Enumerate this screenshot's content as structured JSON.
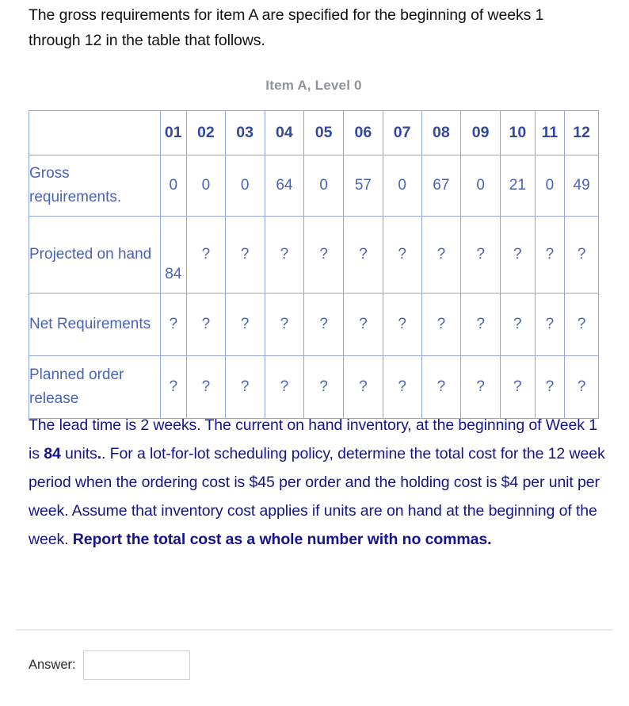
{
  "intro": {
    "text": "The gross requirements for item A are specified for the beginning of weeks 1 through 12 in the table that follows."
  },
  "table": {
    "caption": "Item A, Level 0",
    "corner_header": "",
    "column_headers": [
      "01",
      "02",
      "03",
      "04",
      "05",
      "06",
      "07",
      "08",
      "09",
      "10",
      "11",
      "12"
    ],
    "rows": [
      {
        "label": "Gross requirements.",
        "values": [
          "0",
          "0",
          "0",
          "64",
          "0",
          "57",
          "0",
          "67",
          "0",
          "21",
          "0",
          "49"
        ]
      },
      {
        "label": "Projected on hand",
        "values": [
          "84",
          "?",
          "?",
          "?",
          "?",
          "?",
          "?",
          "?",
          "?",
          "?",
          "?",
          "?"
        ]
      },
      {
        "label": "Net Requirements",
        "values": [
          "?",
          "?",
          "?",
          "?",
          "?",
          "?",
          "?",
          "?",
          "?",
          "?",
          "?",
          "?"
        ]
      },
      {
        "label": "Planned order release",
        "values": [
          "?",
          "?",
          "?",
          "?",
          "?",
          "?",
          "?",
          "?",
          "?",
          "?",
          "?",
          "?"
        ]
      }
    ]
  },
  "question": {
    "part1": "The lead time is 2 weeks.   The current on hand inventory, at the beginning of Week 1 is ",
    "bold_value": "84",
    "part2": " units",
    "part3": ".  For a lot-for-lot scheduling policy, determine the total cost for the 12 week period when the ordering cost is $45 per order and the holding cost is $4 per unit per week.  Assume that inventory cost applies if units are on hand at the beginning of the week. ",
    "bold_instruction": "Report the total cost as a whole number with no commas."
  },
  "answer": {
    "label": "Answer:",
    "value": "",
    "placeholder": ""
  },
  "colors": {
    "table_text": "#4a62b8",
    "table_header_text": "#33499f",
    "table_border": "#93a4d8",
    "caption_text": "#8d9399",
    "question_text": "#151589",
    "intro_text": "#111111",
    "input_border": "#ccd2d8",
    "divider": "#e9ebed"
  }
}
